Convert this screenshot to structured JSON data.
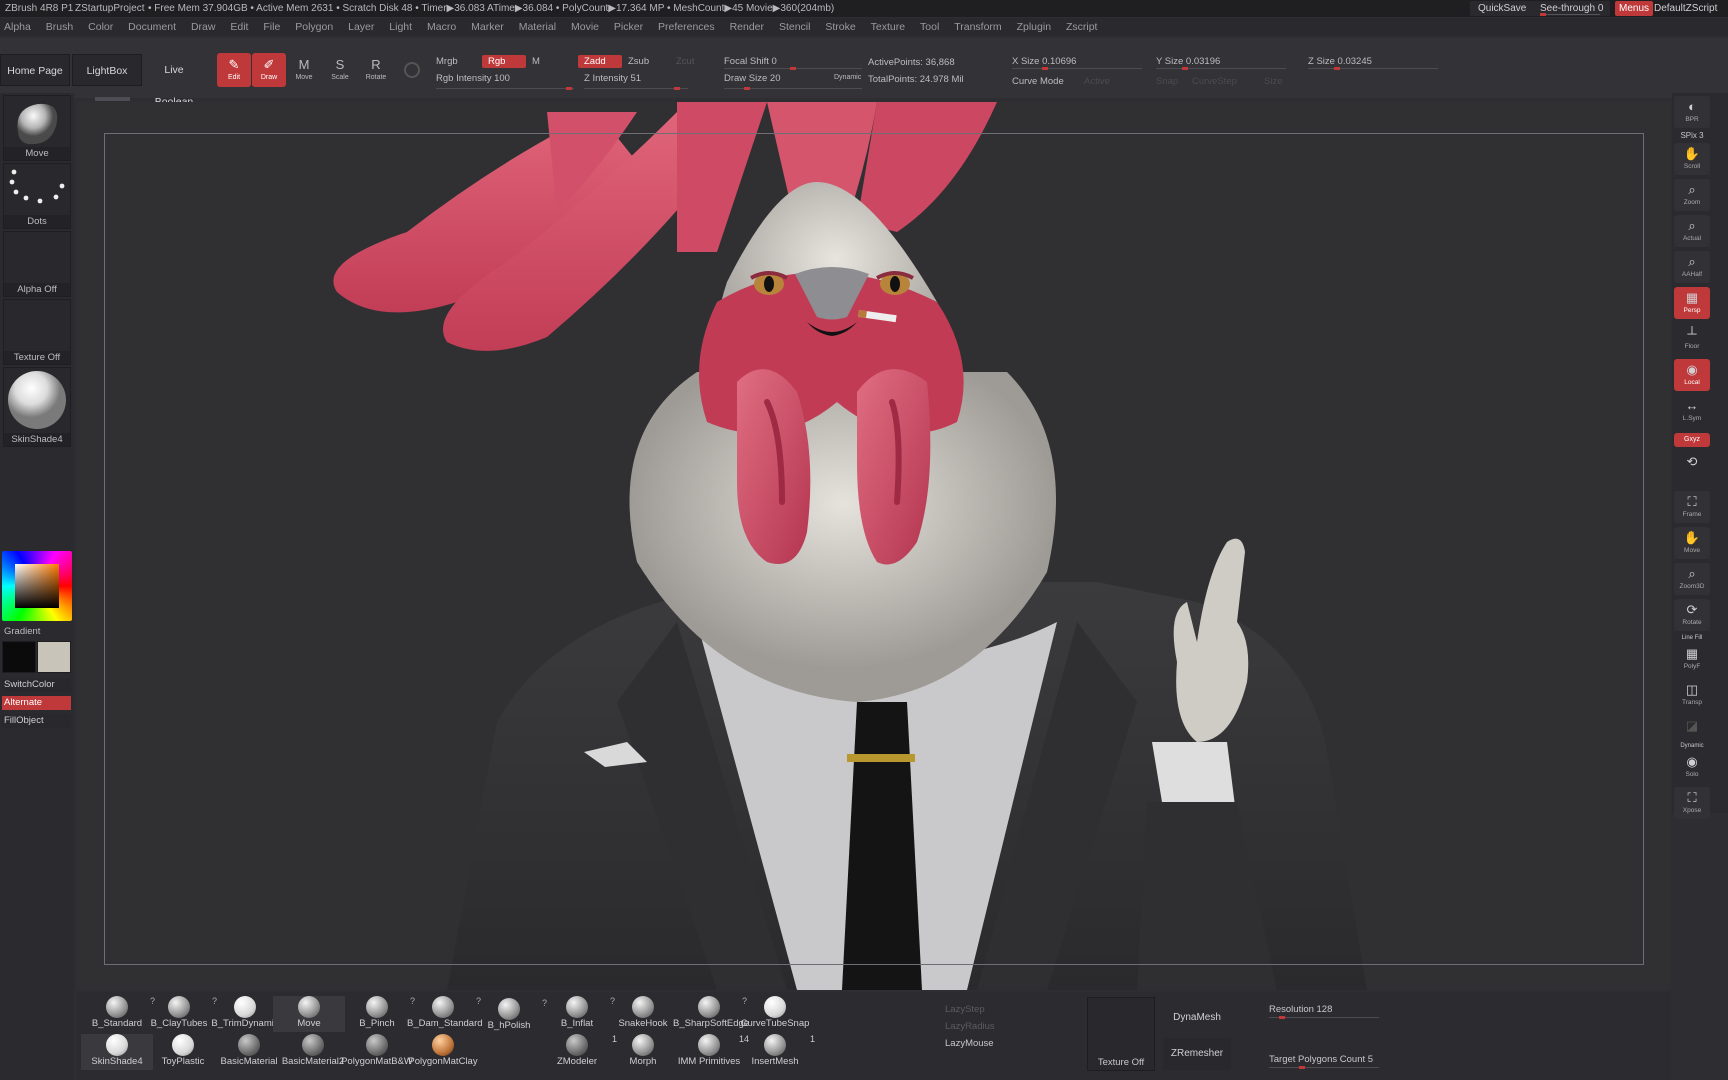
{
  "titlebar": {
    "app_title": "ZBrush 4R8 P1",
    "project": "ZStartupProject",
    "stats": "• Free Mem 37.904GB • Active Mem 2631 • Scratch Disk 48 • Timer▶36.083 ATime▶36.084 • PolyCount▶17.364 MP • MeshCount▶45 Movie▶360(204mb)",
    "quicksave": "QuickSave",
    "see_through": "See-through",
    "see_through_value": "0",
    "menus": "Menus",
    "default_script": "DefaultZScript"
  },
  "menubar": [
    "Alpha",
    "Brush",
    "Color",
    "Document",
    "Draw",
    "Edit",
    "File",
    "Polygon",
    "Layer",
    "Light",
    "Macro",
    "Marker",
    "Material",
    "Movie",
    "Picker",
    "Preferences",
    "Render",
    "Stencil",
    "Stroke",
    "Texture",
    "Tool",
    "Transform",
    "Zplugin",
    "Zscript"
  ],
  "topshelf": {
    "home_page": "Home Page",
    "lightbox": "LightBox",
    "live_boolean": "Live Boolean",
    "edit": "Edit",
    "draw": "Draw",
    "move": "Move",
    "scale": "Scale",
    "rotate": "Rotate",
    "mrgb": "Mrgb",
    "rgb": "Rgb",
    "m": "M",
    "zadd": "Zadd",
    "zsub": "Zsub",
    "zcut": "Zcut",
    "rgb_intensity": "Rgb Intensity 100",
    "z_intensity": "Z Intensity 51",
    "focal_shift": "Focal Shift 0",
    "draw_size": "Draw Size 20",
    "dynamic": "Dynamic",
    "active_points": "ActivePoints: 36,868",
    "total_points": "TotalPoints: 24.978 Mil",
    "x_size": "X Size 0.10696",
    "y_size": "Y Size 0.03196",
    "z_size": "Z Size 0.03245",
    "curve_mode": "Curve Mode",
    "asdim1": "Active",
    "snap": "Snap",
    "curvestep": "CurveStep",
    "size": "Size"
  },
  "leftpanel": {
    "brush": "Move",
    "stroke": "Dots",
    "alpha": "Alpha Off",
    "texture": "Texture Off",
    "material": "SkinShade4",
    "gradient": "Gradient",
    "switch_color": "SwitchColor",
    "alternate": "Alternate",
    "fill_object": "FillObject",
    "main_color": "#0b0b0c",
    "secondary_color": "#c9c4b9"
  },
  "rightpanel": {
    "spix": "SPix 3",
    "buttons": [
      "BPR",
      "Scroll",
      "Zoom",
      "Actual",
      "AAHalf",
      "Persp",
      "Floor",
      "Local",
      "L.Sym",
      "Gxyz",
      "Frame",
      "Move",
      "Zoom3D",
      "Rotate",
      "PolyF",
      "Transp",
      "Ghost",
      "Solo",
      "Xpose"
    ],
    "dynamic": "Dynamic",
    "line_fill": "Line Fill"
  },
  "bottomshelf": {
    "brushes_row1": [
      "B_Standard",
      "B_ClayTubes",
      "B_TrimDynamic",
      "Move",
      "B_Pinch",
      "B_Dam_Standard",
      "B_hPolish",
      "B_Inflat",
      "SnakeHook",
      "B_SharpSoftEdge",
      "CurveTubeSnap"
    ],
    "brushes_row2": [
      "SkinShade4",
      "ToyPlastic",
      "BasicMaterial",
      "BasicMaterial2",
      "PolygonMatB&W",
      "PolygonMatClay",
      "ZModeler",
      "Morph",
      "IMM Primitives",
      "InsertMesh"
    ],
    "zmodeler_count": "1",
    "imm_count": "14",
    "insert_count": "1",
    "lazystep": "LazyStep",
    "lazyradius": "LazyRadius",
    "lazymouse": "LazyMouse",
    "texture_off": "Texture Off",
    "dynamesh": "DynaMesh",
    "zremesher": "ZRemesher",
    "resolution": "Resolution 128",
    "target_polygons": "Target Polygons Count 5"
  },
  "colors": {
    "accent_red": "#c0393a",
    "ui_bg": "#2e2d31",
    "canvas_bg": "#303033"
  }
}
